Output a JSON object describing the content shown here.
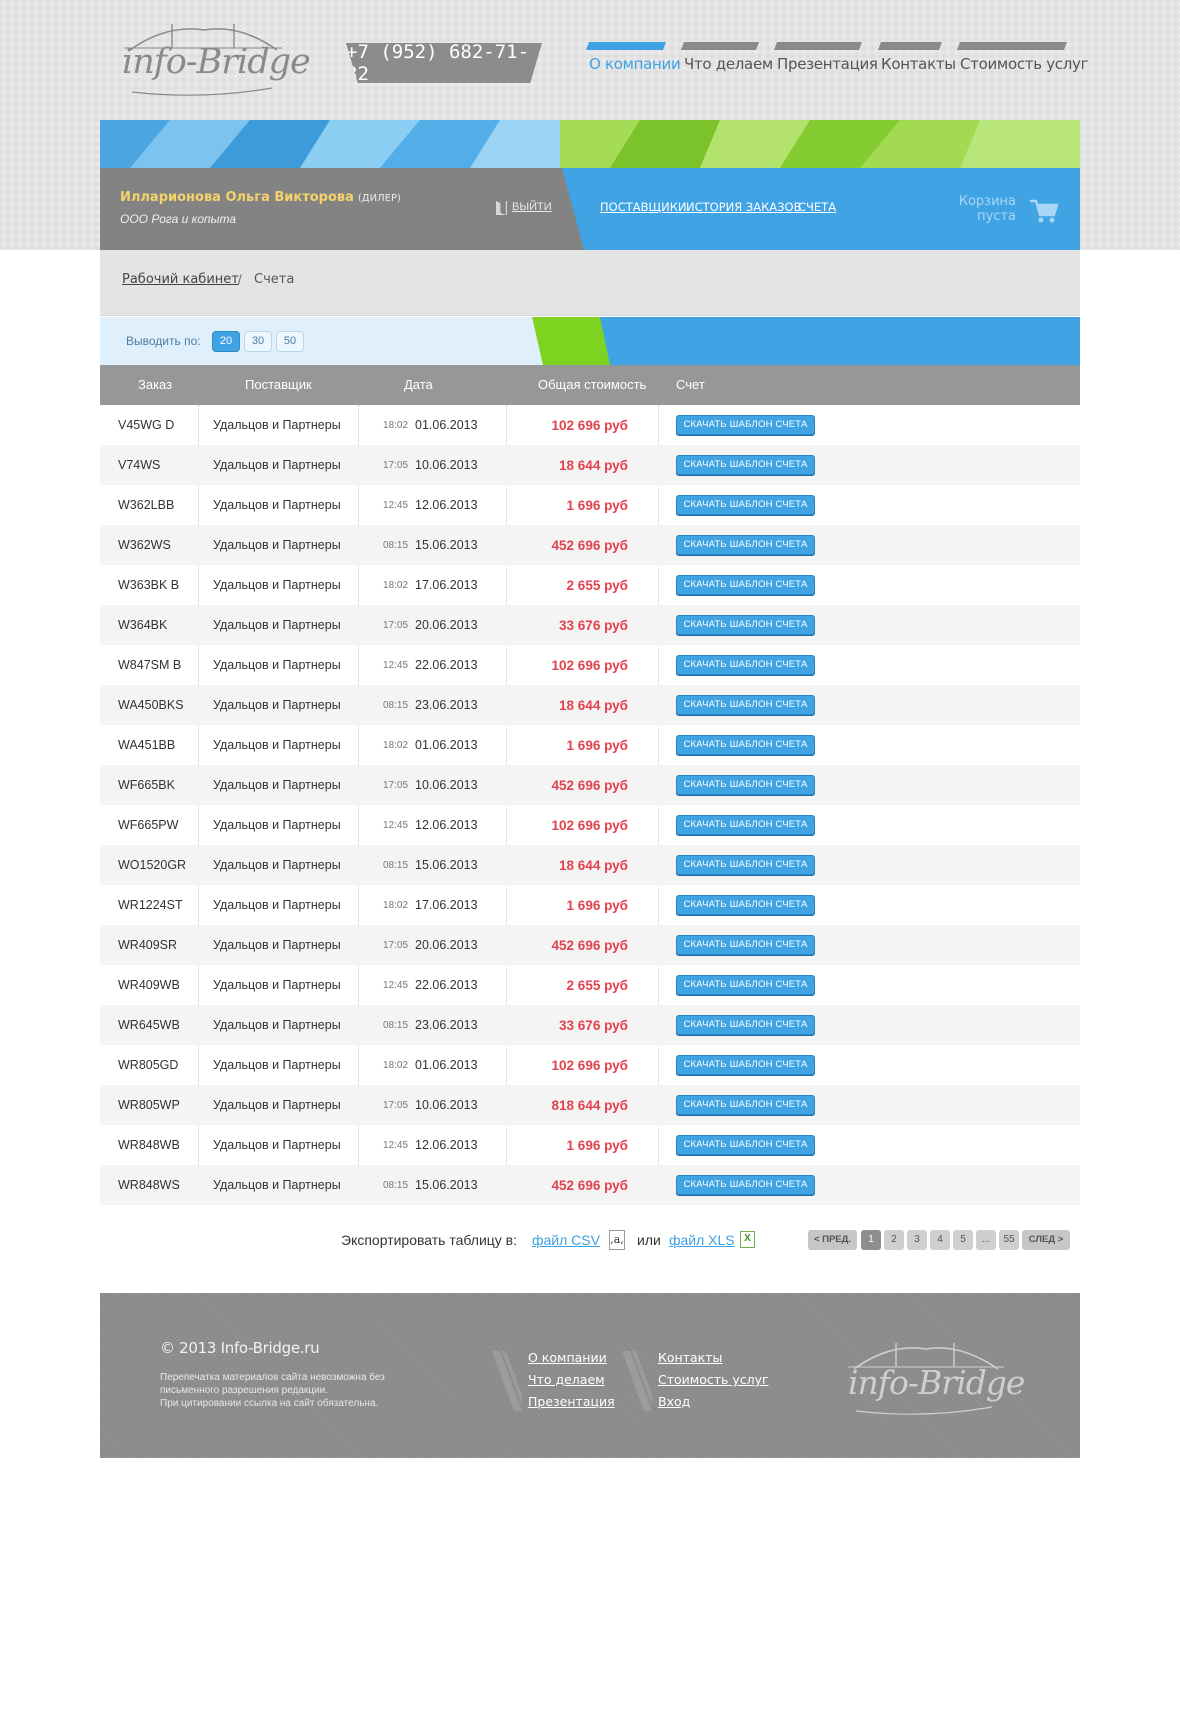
{
  "header": {
    "logo_text": "info-Bridge",
    "phone": "+7 (952) 682-71-82",
    "nav": [
      {
        "label": "О компании",
        "active": true
      },
      {
        "label": "Что делаем",
        "active": false
      },
      {
        "label": "Презентация",
        "active": false
      },
      {
        "label": "Контакты",
        "active": false
      },
      {
        "label": "Стоимость услуг",
        "active": false
      }
    ]
  },
  "user": {
    "name": "Илларионова Ольга Викторова",
    "role": "(ДИЛЕР)",
    "org": "ООО Рога и копыта",
    "logout_label": "ВЫЙТИ",
    "links": [
      "ПОСТАВЩИКИ",
      "ИСТОРИЯ ЗАКАЗОВ",
      "СЧЕТА"
    ],
    "cart_line1": "Корзина",
    "cart_line2": "пуста"
  },
  "breadcrumb": {
    "link": "Рабочий кабинет",
    "separator": "/",
    "current": "Счета"
  },
  "perpage": {
    "label": "Выводить по:",
    "options": [
      "20",
      "30",
      "50"
    ],
    "selected": "20"
  },
  "table": {
    "headers": [
      "Заказ",
      "Поставщик",
      "Дата",
      "Общая стоимость",
      "Счет"
    ],
    "button_label": "СКАЧАТЬ ШАБЛОН СЧЕТА",
    "rows": [
      {
        "order": "V45WG D",
        "supplier": "Удальцов и Партнеры",
        "time": "18:02",
        "date": "01.06.2013",
        "price": "102 696 руб"
      },
      {
        "order": "V74WS",
        "supplier": "Удальцов и Партнеры",
        "time": "17:05",
        "date": "10.06.2013",
        "price": "18 644 руб"
      },
      {
        "order": "W362LBB",
        "supplier": "Удальцов и Партнеры",
        "time": "12:45",
        "date": "12.06.2013",
        "price": "1 696 руб"
      },
      {
        "order": "W362WS",
        "supplier": "Удальцов и Партнеры",
        "time": "08:15",
        "date": "15.06.2013",
        "price": "452 696 руб"
      },
      {
        "order": "W363BK B",
        "supplier": "Удальцов и Партнеры",
        "time": "18:02",
        "date": "17.06.2013",
        "price": "2 655 руб"
      },
      {
        "order": "W364BK",
        "supplier": "Удальцов и Партнеры",
        "time": "17:05",
        "date": "20.06.2013",
        "price": "33 676 руб"
      },
      {
        "order": "W847SM B",
        "supplier": "Удальцов и Партнеры",
        "time": "12:45",
        "date": "22.06.2013",
        "price": "102 696 руб"
      },
      {
        "order": "WA450BKS",
        "supplier": "Удальцов и Партнеры",
        "time": "08:15",
        "date": "23.06.2013",
        "price": "18 644 руб"
      },
      {
        "order": "WA451BB",
        "supplier": "Удальцов и Партнеры",
        "time": "18:02",
        "date": "01.06.2013",
        "price": "1 696 руб"
      },
      {
        "order": "WF665BK",
        "supplier": "Удальцов и Партнеры",
        "time": "17:05",
        "date": "10.06.2013",
        "price": "452 696 руб"
      },
      {
        "order": "WF665PW",
        "supplier": "Удальцов и Партнеры",
        "time": "12:45",
        "date": "12.06.2013",
        "price": "102 696 руб"
      },
      {
        "order": "WO1520GR",
        "supplier": "Удальцов и Партнеры",
        "time": "08:15",
        "date": "15.06.2013",
        "price": "18 644 руб"
      },
      {
        "order": "WR1224ST",
        "supplier": "Удальцов и Партнеры",
        "time": "18:02",
        "date": "17.06.2013",
        "price": "1 696 руб"
      },
      {
        "order": "WR409SR",
        "supplier": "Удальцов и Партнеры",
        "time": "17:05",
        "date": "20.06.2013",
        "price": "452 696 руб"
      },
      {
        "order": "WR409WB",
        "supplier": "Удальцов и Партнеры",
        "time": "12:45",
        "date": "22.06.2013",
        "price": "2 655 руб"
      },
      {
        "order": "WR645WB",
        "supplier": "Удальцов и Партнеры",
        "time": "08:15",
        "date": "23.06.2013",
        "price": "33 676 руб"
      },
      {
        "order": "WR805GD",
        "supplier": "Удальцов и Партнеры",
        "time": "18:02",
        "date": "01.06.2013",
        "price": "102 696 руб"
      },
      {
        "order": "WR805WP",
        "supplier": "Удальцов и Партнеры",
        "time": "17:05",
        "date": "10.06.2013",
        "price": "818 644 руб"
      },
      {
        "order": "WR848WB",
        "supplier": "Удальцов и Партнеры",
        "time": "12:45",
        "date": "12.06.2013",
        "price": "1 696 руб"
      },
      {
        "order": "WR848WS",
        "supplier": "Удальцов и Партнеры",
        "time": "08:15",
        "date": "15.06.2013",
        "price": "452 696 руб"
      }
    ]
  },
  "export": {
    "label": "Экспортировать таблицу в:",
    "csv_label": "файл CSV",
    "csv_icon": ",a,",
    "or": "или",
    "xls_label": "файл XLS",
    "xls_icon": "X"
  },
  "pagination": {
    "prev": "< ПРЕД.",
    "pages": [
      "1",
      "2",
      "3",
      "4",
      "5",
      "...",
      "55"
    ],
    "current": "1",
    "next": "СЛЕД >"
  },
  "footer": {
    "copyright": "© 2013 Info-Bridge.ru",
    "note_line1": "Перепечатка материалов сайта невозможна без",
    "note_line2": "письменного разрешения редакции.",
    "note_line3": "При цитировании ссылка на сайт обязательна.",
    "col1": [
      "О компании",
      "Что делаем",
      "Презентация"
    ],
    "col2": [
      "Контакты",
      "Стоимость услуг",
      "Вход"
    ],
    "logo_text": "info-Bridge"
  },
  "colors": {
    "accent_blue": "#3fa3e4",
    "accent_green": "#7ed321",
    "price_red": "#e2424e",
    "user_name_yellow": "#f5d36b"
  }
}
